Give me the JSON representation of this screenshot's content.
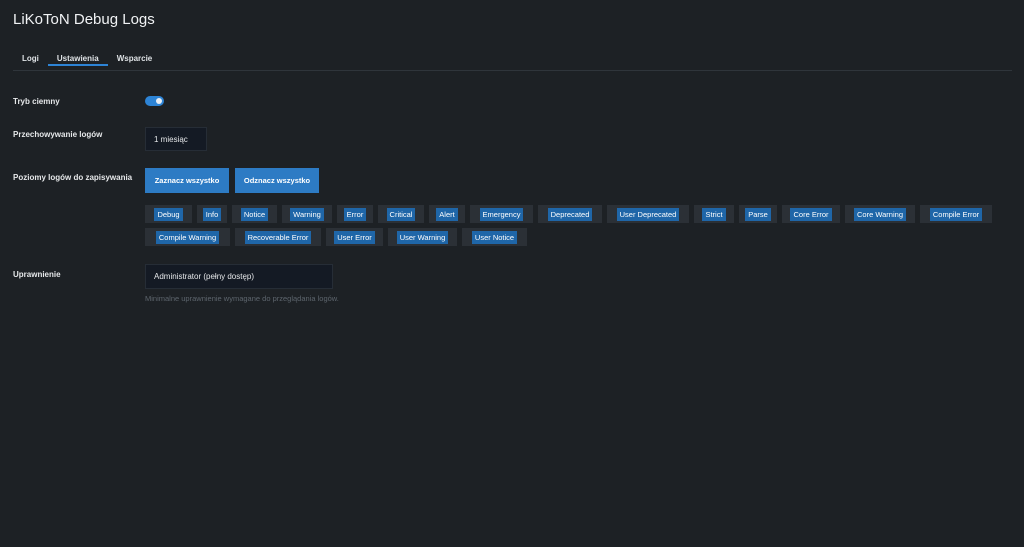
{
  "app": {
    "title": "LiKoToN Debug Logs"
  },
  "tabs": [
    {
      "label": "Logi",
      "active": false
    },
    {
      "label": "Ustawienia",
      "active": true
    },
    {
      "label": "Wsparcie",
      "active": false
    }
  ],
  "settings": {
    "dark_mode": {
      "label": "Tryb ciemny",
      "enabled": true
    },
    "retention": {
      "label": "Przechowywanie logów",
      "value": "1 miesiąc"
    },
    "levels": {
      "label": "Poziomy logów do zapisywania",
      "select_all": "Zaznacz wszystko",
      "deselect_all": "Odznacz wszystko",
      "items": [
        "Debug",
        "Info",
        "Notice",
        "Warning",
        "Error",
        "Critical",
        "Alert",
        "Emergency",
        "Deprecated",
        "User Deprecated",
        "Strict",
        "Parse",
        "Core Error",
        "Core Warning",
        "Compile Error",
        "Compile Warning",
        "Recoverable Error",
        "User Error",
        "User Warning",
        "User Notice"
      ]
    },
    "permission": {
      "label": "Uprawnienie",
      "value": "Administrator (pełny dostęp)",
      "help": "Minimalne uprawnienie wymagane do przeglądania logów."
    }
  },
  "colors": {
    "accent": "#2d84d6",
    "background": "#1d2125",
    "chip_bg": "#2b3036",
    "chip_label": "#1f66a8"
  }
}
